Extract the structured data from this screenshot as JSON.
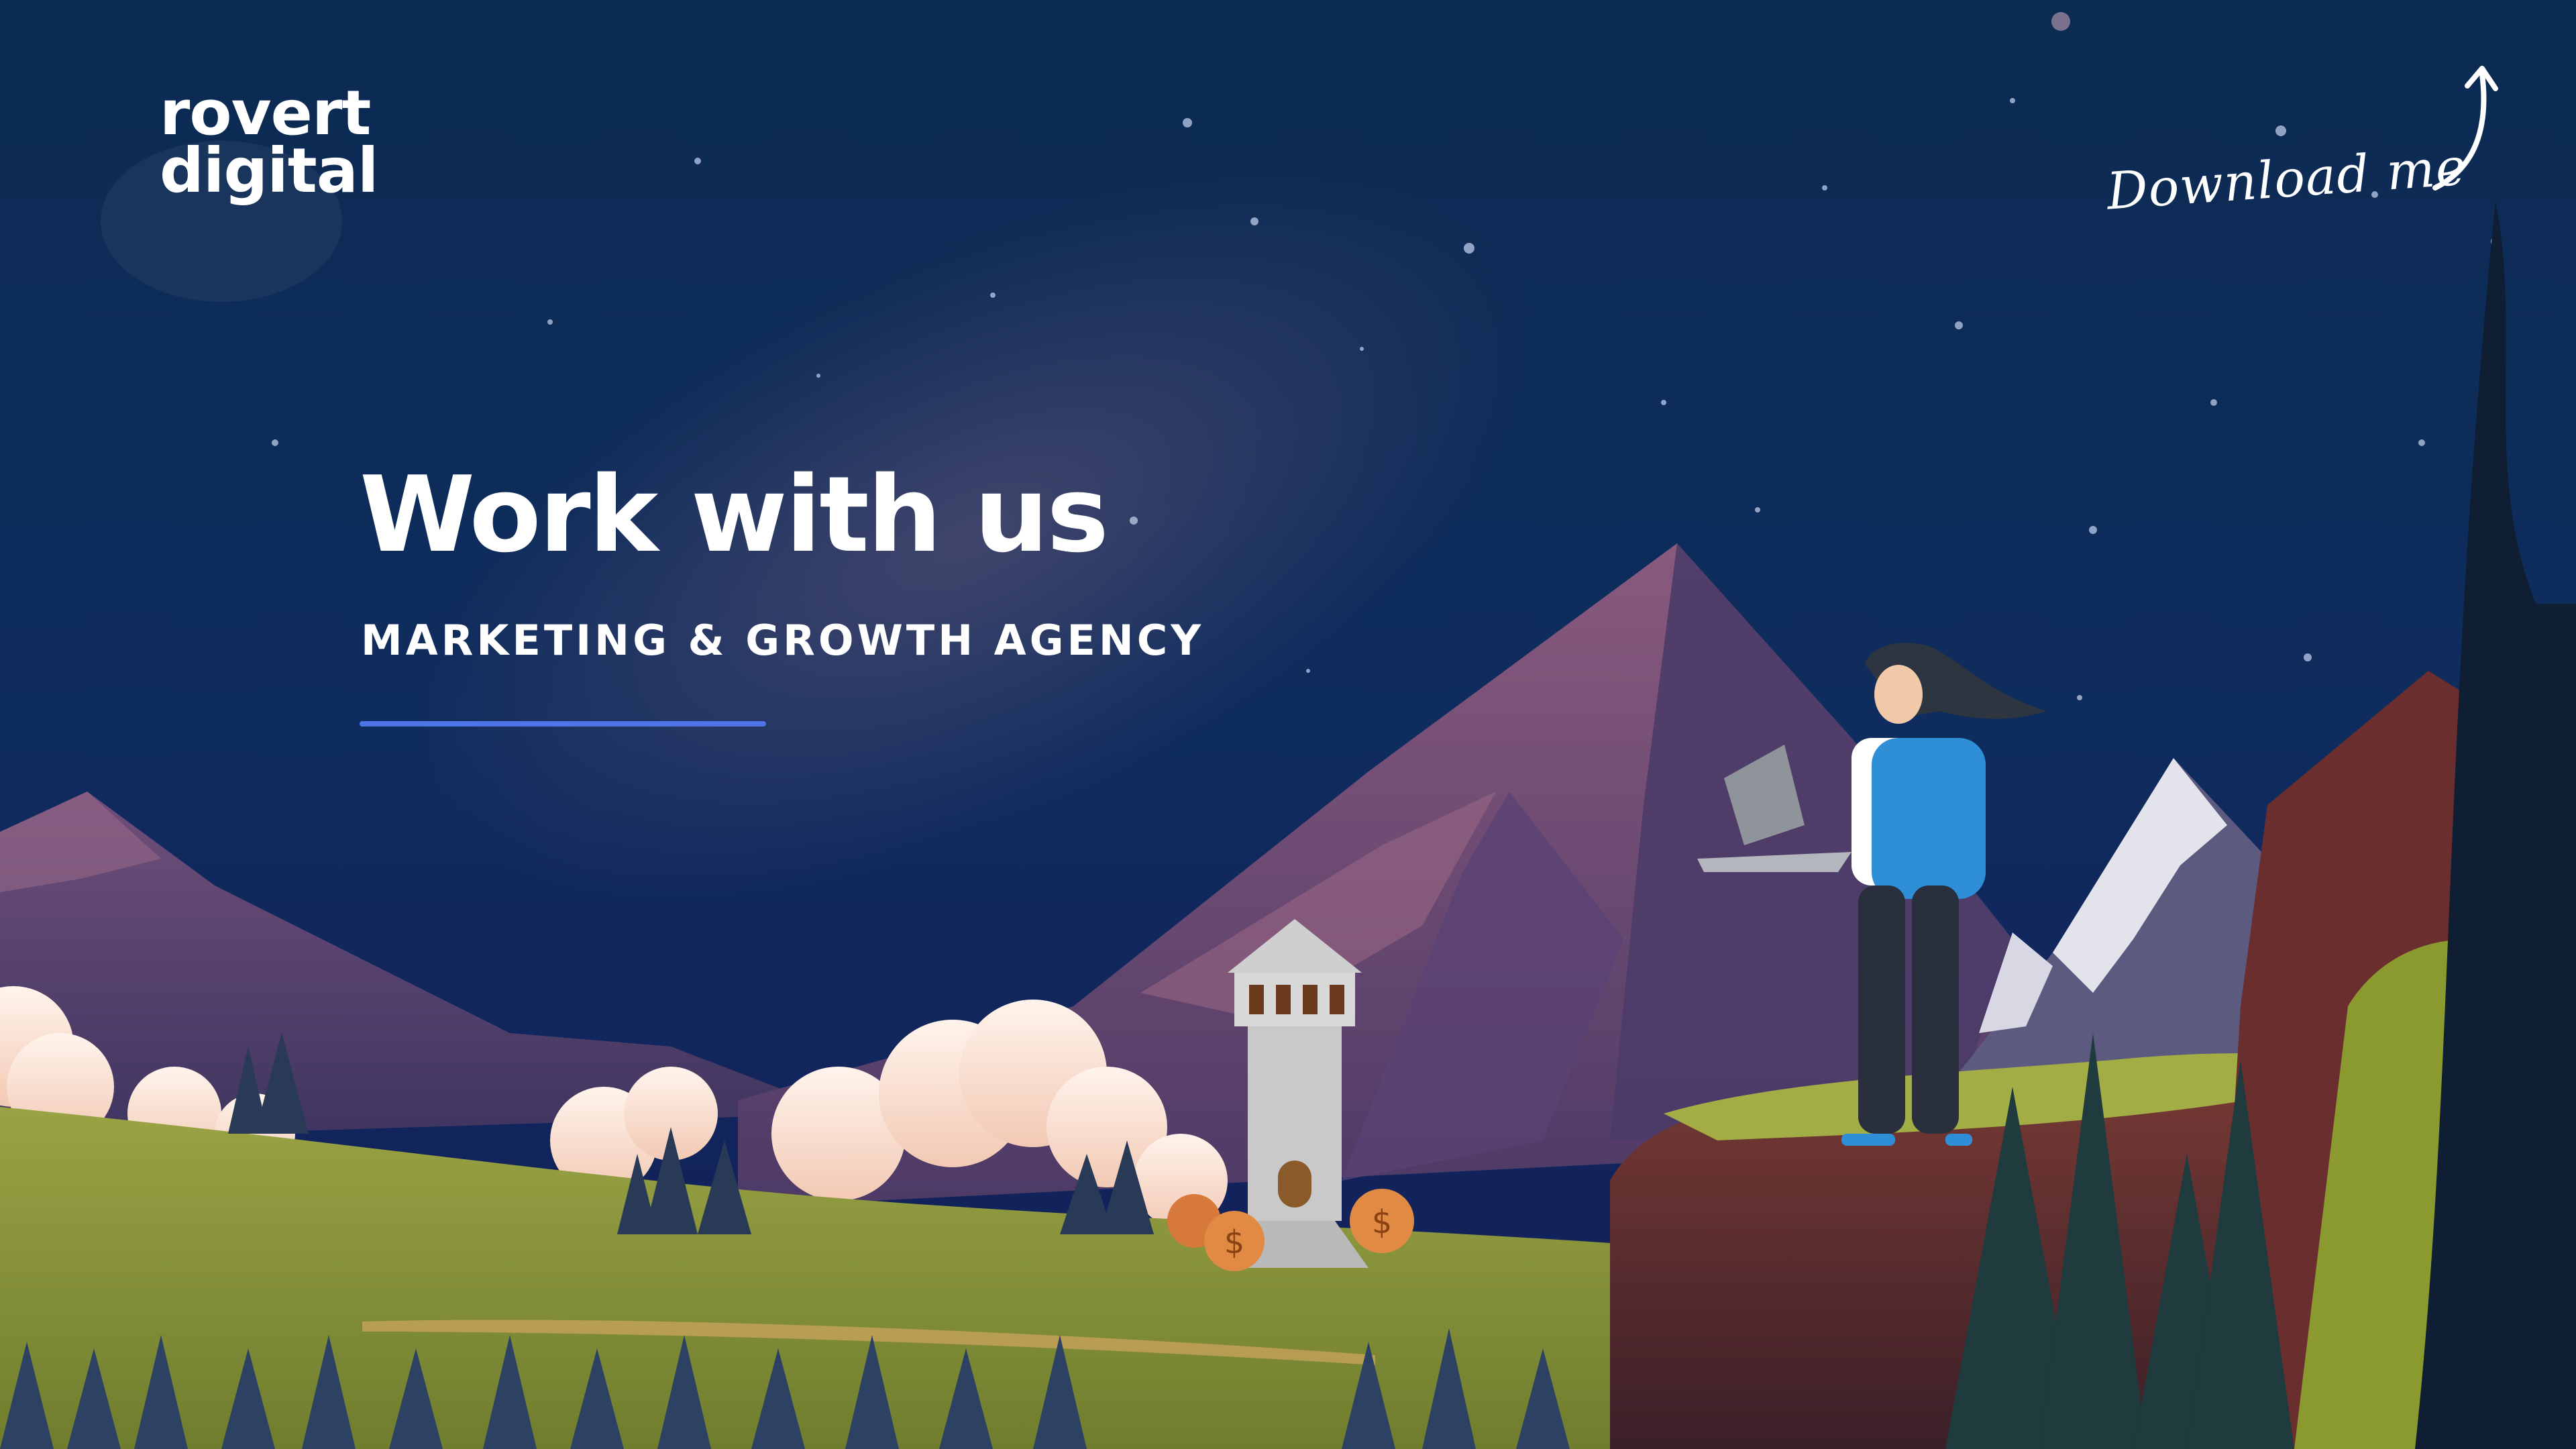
{
  "brand": {
    "line1": "rovert",
    "line2": "digital"
  },
  "download": {
    "label": "Download me",
    "icon": "curved-arrow-up-icon"
  },
  "hero": {
    "title": "Work with us",
    "subtitle": "MARKETING & GROWTH AGENCY"
  },
  "colors": {
    "sky_top": "#0b2a55",
    "sky_bottom": "#122e63",
    "accent": "#4f74e8",
    "meadow": "#8f9e3c",
    "mountain": "#6e4a72",
    "text": "#ffffff"
  }
}
